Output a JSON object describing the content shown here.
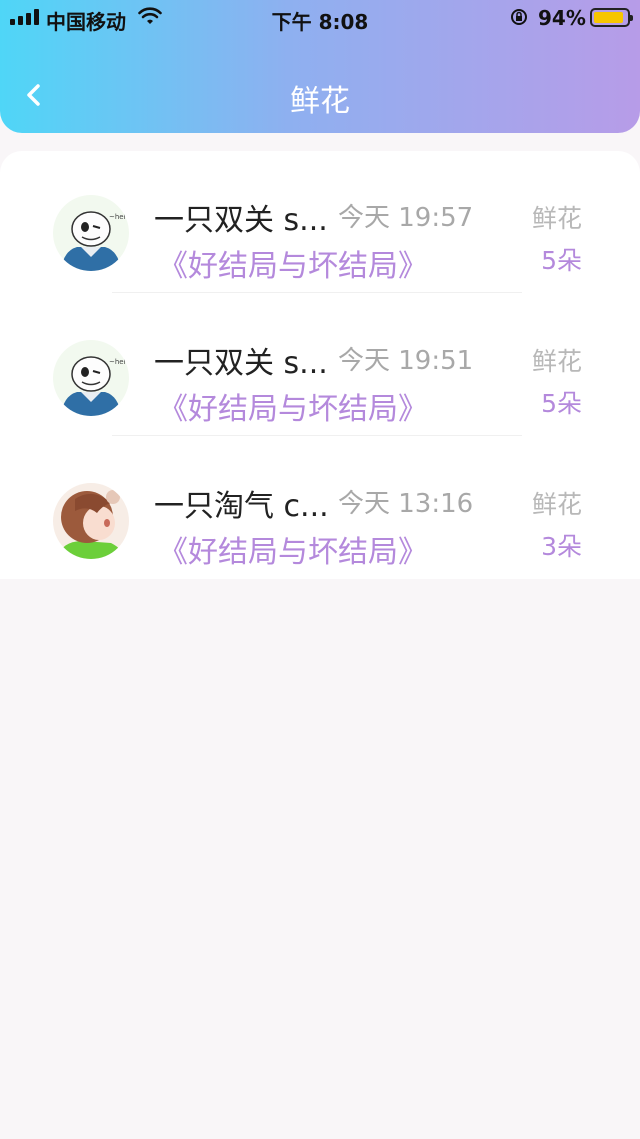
{
  "status_bar": {
    "carrier": "中国移动",
    "time": "下午 8:08",
    "battery": "94%"
  },
  "header": {
    "title": "鲜花"
  },
  "gifts": [
    {
      "name": "一只双关 s...",
      "time": "今天 19:57",
      "book": "《好结局与坏结局》",
      "gift_label": "鲜花",
      "count": "5朵",
      "avatar": "skeleton-avatar"
    },
    {
      "name": "一只双关 s...",
      "time": "今天 19:51",
      "book": "《好结局与坏结局》",
      "gift_label": "鲜花",
      "count": "5朵",
      "avatar": "skeleton-avatar"
    },
    {
      "name": "一只淘气 c...",
      "time": "今天 13:16",
      "book": "《好结局与坏结局》",
      "gift_label": "鲜花",
      "count": "3朵",
      "avatar": "child-avatar"
    }
  ],
  "colors": {
    "header_gradient": [
      "#4fd6f7",
      "#b79ce8"
    ],
    "accent": "#b489dc",
    "muted": "#a8a8a8"
  }
}
